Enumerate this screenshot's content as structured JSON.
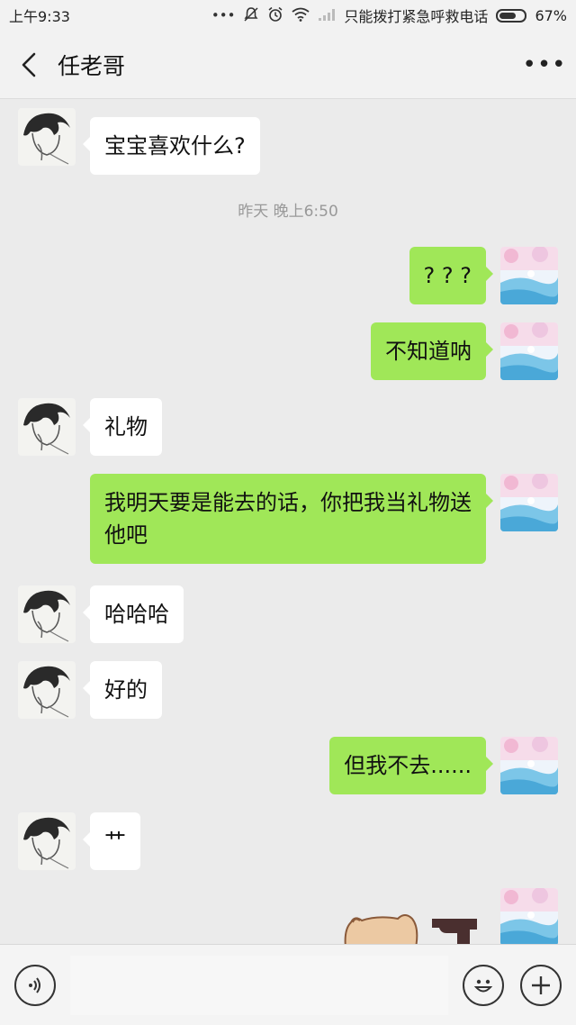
{
  "status_bar": {
    "time": "上午9:33",
    "dots": "•••",
    "carrier_text": "只能拨打紧急呼救电话",
    "battery_percent": "67%",
    "battery_level": 0.67
  },
  "header": {
    "title": "任老哥",
    "more": "•••"
  },
  "messages": [
    {
      "side": "left",
      "text": "宝宝喜欢什么?"
    },
    {
      "type": "timestamp",
      "text": "昨天 晚上6:50"
    },
    {
      "side": "right",
      "text": "? ? ?"
    },
    {
      "side": "right",
      "text": "不知道呐"
    },
    {
      "side": "left",
      "text": "礼物"
    },
    {
      "side": "right",
      "text": "我明天要是能去的话，你把我当礼物送他吧"
    },
    {
      "side": "left",
      "text": "哈哈哈"
    },
    {
      "side": "left",
      "text": "好的"
    },
    {
      "side": "right",
      "text": "但我不去......"
    },
    {
      "side": "left",
      "text": "艹"
    },
    {
      "side": "right",
      "type": "sticker"
    }
  ],
  "colors": {
    "background": "#ebebeb",
    "sent_bubble": "#a0e758",
    "received_bubble": "#ffffff"
  },
  "icons": {
    "back": "chevron-left-icon",
    "more": "more-dots-icon",
    "voice": "voice-icon",
    "emoji": "emoji-icon",
    "plus": "plus-icon"
  }
}
